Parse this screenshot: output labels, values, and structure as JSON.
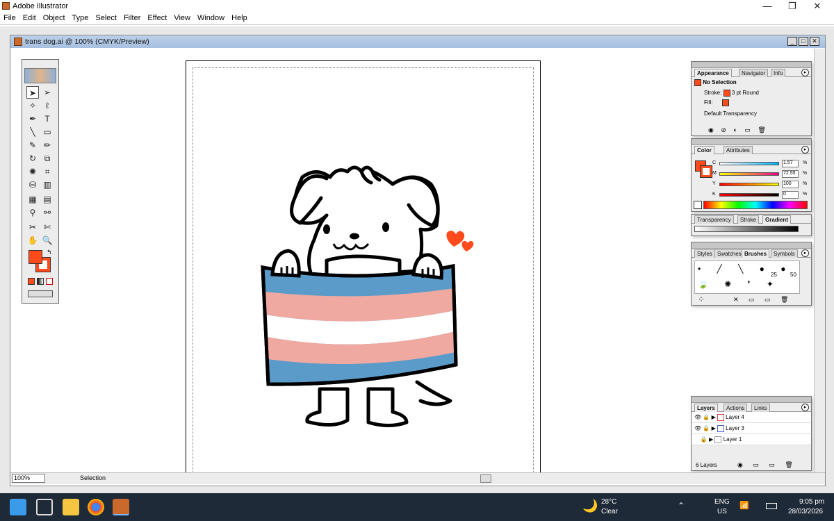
{
  "app": {
    "title": "Adobe Illustrator"
  },
  "menu": [
    "File",
    "Edit",
    "Object",
    "Type",
    "Select",
    "Filter",
    "Effect",
    "View",
    "Window",
    "Help"
  ],
  "document": {
    "title": "trans dog.ai @ 100% (CMYK/Preview)"
  },
  "status": {
    "zoom": "100%",
    "tool": "Selection"
  },
  "appearance": {
    "tabs": [
      "Appearance",
      "Navigator",
      "Info"
    ],
    "selection": "No Selection",
    "stroke_label": "Stroke:",
    "stroke_value": "3 pt Round",
    "fill_label": "Fill:",
    "transparency": "Default Transparency"
  },
  "color": {
    "tabs": [
      "Color",
      "Attributes"
    ],
    "channels": [
      {
        "label": "C",
        "value": "1.57",
        "unit": "%"
      },
      {
        "label": "M",
        "value": "72.55",
        "unit": "%"
      },
      {
        "label": "Y",
        "value": "100",
        "unit": "%"
      },
      {
        "label": "K",
        "value": "0",
        "unit": "%"
      }
    ]
  },
  "gradient": {
    "tabs": [
      "Transparency",
      "Stroke",
      "Gradient"
    ]
  },
  "brushes": {
    "tabs": [
      "Styles",
      "Swatches",
      "Brushes",
      "Symbols"
    ],
    "sizes": [
      "25",
      "50"
    ]
  },
  "layers": {
    "tabs": [
      "Layers",
      "Actions",
      "Links"
    ],
    "items": [
      "Layer 4",
      "Layer 3",
      "Layer 1"
    ],
    "count": "6 Layers"
  },
  "taskbar": {
    "weather_temp": "28°C",
    "weather_cond": "Clear",
    "lang1": "ENG",
    "lang2": "US",
    "time": "9:05 pm",
    "date": "28/03/2026"
  },
  "colors": {
    "accent": "#ff4a1c",
    "flag_blue": "#5b9bc9",
    "flag_pink": "#f0a9a0",
    "flag_white": "#ffffff",
    "heart": "#ff4a1c"
  }
}
